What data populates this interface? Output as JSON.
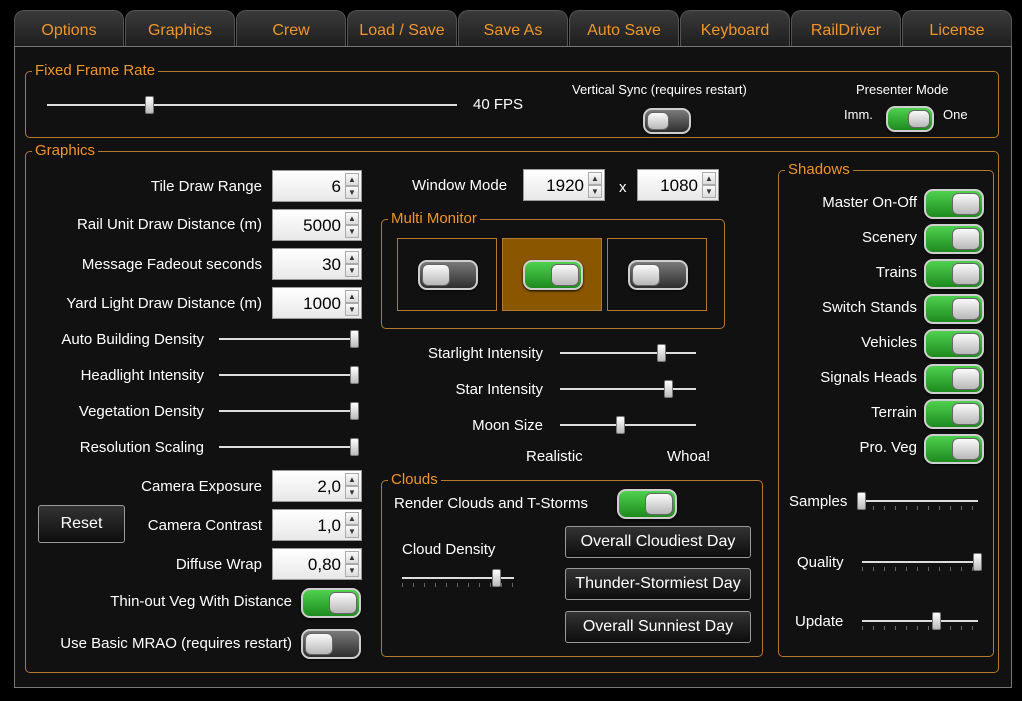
{
  "tabs": [
    "Options",
    "Graphics",
    "Crew",
    "Load / Save",
    "Save As",
    "Auto Save",
    "Keyboard",
    "RailDriver",
    "License"
  ],
  "frame_rate": {
    "title": "Fixed Frame Rate",
    "fps_label": "40 FPS",
    "fps_value": 40,
    "vsync_label": "Vertical Sync (requires restart)",
    "vsync_on": false,
    "presenter_title": "Presenter Mode",
    "presenter_left": "Imm.",
    "presenter_right": "One",
    "presenter_on": true
  },
  "graphics": {
    "title": "Graphics",
    "tile_draw_range": {
      "label": "Tile Draw Range",
      "value": "6"
    },
    "rail_unit_draw": {
      "label": "Rail Unit Draw Distance (m)",
      "value": "5000"
    },
    "message_fadeout": {
      "label": "Message Fadeout seconds",
      "value": "30"
    },
    "yard_light_draw": {
      "label": "Yard Light Draw Distance (m)",
      "value": "1000"
    },
    "auto_building_density": {
      "label": "Auto Building Density",
      "level": 1.0
    },
    "headlight_intensity": {
      "label": "Headlight Intensity",
      "level": 1.0
    },
    "vegetation_density": {
      "label": "Vegetation Density",
      "level": 1.0
    },
    "resolution_scaling": {
      "label": "Resolution Scaling",
      "level": 1.0
    },
    "camera_exposure": {
      "label": "Camera Exposure",
      "value": "2,0"
    },
    "camera_contrast": {
      "label": "Camera Contrast",
      "value": "1,0"
    },
    "diffuse_wrap": {
      "label": "Diffuse Wrap",
      "value": "0,80"
    },
    "reset_label": "Reset",
    "thin_out_veg": {
      "label": "Thin-out Veg With Distance",
      "on": true
    },
    "basic_mrao": {
      "label": "Use Basic MRAO (requires restart)",
      "on": false
    },
    "window_mode": {
      "label": "Window Mode",
      "width": "1920",
      "x": "x",
      "height": "1080"
    },
    "multi_monitor": {
      "title": "Multi Monitor",
      "screens": [
        false,
        true,
        false
      ],
      "selected": 1
    },
    "starlight_intensity": {
      "label": "Starlight Intensity",
      "level": 0.75
    },
    "star_intensity": {
      "label": "Star Intensity",
      "level": 0.8
    },
    "moon_size": {
      "label": "Moon Size",
      "level": 0.45
    },
    "moon_min": "Realistic",
    "moon_max": "Whoa!"
  },
  "clouds": {
    "title": "Clouds",
    "render_label": "Render Clouds and T-Storms",
    "render_on": true,
    "density_label": "Cloud Density",
    "density_level": 0.85,
    "btn_cloudiest": "Overall Cloudiest Day",
    "btn_stormiest": "Thunder-Stormiest Day",
    "btn_sunniest": "Overall Sunniest Day"
  },
  "shadows": {
    "title": "Shadows",
    "items": [
      {
        "label": "Master On-Off",
        "on": true
      },
      {
        "label": "Scenery",
        "on": true
      },
      {
        "label": "Trains",
        "on": true
      },
      {
        "label": "Switch Stands",
        "on": true
      },
      {
        "label": "Vehicles",
        "on": true
      },
      {
        "label": "Signals Heads",
        "on": true
      },
      {
        "label": "Terrain",
        "on": true
      },
      {
        "label": "Pro. Veg",
        "on": true
      }
    ],
    "samples": {
      "label": "Samples",
      "level": 0.0
    },
    "quality": {
      "label": "Quality",
      "level": 1.0
    },
    "update": {
      "label": "Update",
      "level": 0.65
    }
  },
  "colors": {
    "accent": "#f0952a",
    "border": "#b47a2d",
    "toggle_on": "#2fb52f",
    "selected_monitor": "#8a5600"
  }
}
